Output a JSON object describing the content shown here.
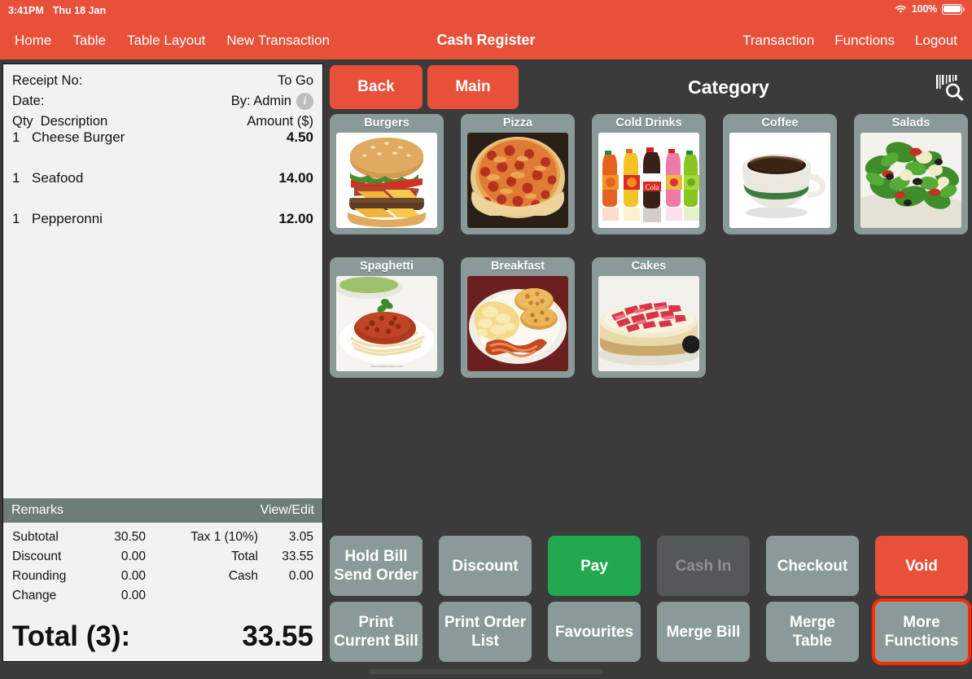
{
  "statusbar": {
    "time": "3:41PM",
    "date": "Thu 18 Jan",
    "battery_pct": "100%",
    "wifi_icon": "wifi-icon",
    "battery_icon": "battery-icon"
  },
  "navbar": {
    "title": "Cash Register",
    "left_items": [
      {
        "label": "Home",
        "name": "nav-item-home"
      },
      {
        "label": "Table",
        "name": "nav-item-table"
      },
      {
        "label": "Table Layout",
        "name": "nav-item-table-layout"
      },
      {
        "label": "New Transaction",
        "name": "nav-item-new-transaction"
      }
    ],
    "right_items": [
      {
        "label": "Transaction",
        "name": "nav-item-transaction"
      },
      {
        "label": "Functions",
        "name": "nav-item-functions"
      },
      {
        "label": "Logout",
        "name": "nav-item-logout"
      }
    ]
  },
  "receipt": {
    "receipt_no_label": "Receipt No:",
    "receipt_no_value": "",
    "order_type": "To Go",
    "date_label": "Date:",
    "date_value": "",
    "cashier": "By: Admin",
    "info_icon": "info-icon",
    "col_qty": "Qty",
    "col_description": "Description",
    "col_amount": "Amount ($)",
    "items": [
      {
        "qty": "1",
        "description": "Cheese Burger",
        "amount": "4.50"
      },
      {
        "qty": "1",
        "description": "Seafood",
        "amount": "14.00"
      },
      {
        "qty": "1",
        "description": "Pepperonni",
        "amount": "12.00"
      }
    ],
    "remarks_label": "Remarks",
    "remarks_action": "View/Edit",
    "totals": {
      "subtotal_label": "Subtotal",
      "subtotal_value": "30.50",
      "discount_label": "Discount",
      "discount_value": "0.00",
      "rounding_label": "Rounding",
      "rounding_value": "0.00",
      "change_label": "Change",
      "change_value": "0.00",
      "tax_label": "Tax 1 (10%)",
      "tax_value": "3.05",
      "total_label": "Total",
      "total_value": "33.55",
      "cash_label": "Cash",
      "cash_value": "0.00"
    },
    "grand_total_label": "Total (3):",
    "grand_total_value": "33.55"
  },
  "category_header": {
    "back_label": "Back",
    "main_label": "Main",
    "title": "Category",
    "scan_icon": "barcode-scan-search-icon"
  },
  "categories": [
    {
      "label": "Burgers",
      "name": "category-tile-burgers",
      "image": "burger-image"
    },
    {
      "label": "Pizza",
      "name": "category-tile-pizza",
      "image": "pizza-image"
    },
    {
      "label": "Cold Drinks",
      "name": "category-tile-cold-drinks",
      "image": "soda-bottles-image"
    },
    {
      "label": "Coffee",
      "name": "category-tile-coffee",
      "image": "coffee-cup-image"
    },
    {
      "label": "Salads",
      "name": "category-tile-salads",
      "image": "salad-image"
    },
    {
      "label": "Spaghetti",
      "name": "category-tile-spaghetti",
      "image": "spaghetti-image"
    },
    {
      "label": "Breakfast",
      "name": "category-tile-breakfast",
      "image": "breakfast-image"
    },
    {
      "label": "Cakes",
      "name": "category-tile-cakes",
      "image": "cheesecake-image"
    }
  ],
  "function_buttons": [
    {
      "label": "Hold Bill\nSend Order",
      "name": "hold-bill-send-order-button",
      "style": "gray",
      "disabled": false,
      "highlight": false
    },
    {
      "label": "Discount",
      "name": "discount-button",
      "style": "gray",
      "disabled": false,
      "highlight": false
    },
    {
      "label": "Pay",
      "name": "pay-button",
      "style": "green",
      "disabled": false,
      "highlight": false
    },
    {
      "label": "Cash In",
      "name": "cash-in-button",
      "style": "gray",
      "disabled": true,
      "highlight": false
    },
    {
      "label": "Checkout",
      "name": "checkout-button",
      "style": "gray",
      "disabled": false,
      "highlight": false
    },
    {
      "label": "Void",
      "name": "void-button",
      "style": "red",
      "disabled": false,
      "highlight": false
    },
    {
      "label": "Print\nCurrent Bill",
      "name": "print-current-bill-button",
      "style": "gray",
      "disabled": false,
      "highlight": false
    },
    {
      "label": "Print Order\nList",
      "name": "print-order-list-button",
      "style": "gray",
      "disabled": false,
      "highlight": false
    },
    {
      "label": "Favourites",
      "name": "favourites-button",
      "style": "gray",
      "disabled": false,
      "highlight": false
    },
    {
      "label": "Merge Bill",
      "name": "merge-bill-button",
      "style": "gray",
      "disabled": false,
      "highlight": false
    },
    {
      "label": "Merge Table",
      "name": "merge-table-button",
      "style": "gray",
      "disabled": false,
      "highlight": false
    },
    {
      "label": "More\nFunctions",
      "name": "more-functions-button",
      "style": "gray",
      "disabled": false,
      "highlight": true
    }
  ],
  "colors": {
    "brand_red": "#e8503a",
    "pay_green": "#22a84f",
    "button_gray": "#8a9a98",
    "background_dark": "#3b3b3b",
    "receipt_bg": "#f2f2f0",
    "remarks_bar": "#6e7d79",
    "highlight_outline": "#ff2a00"
  }
}
